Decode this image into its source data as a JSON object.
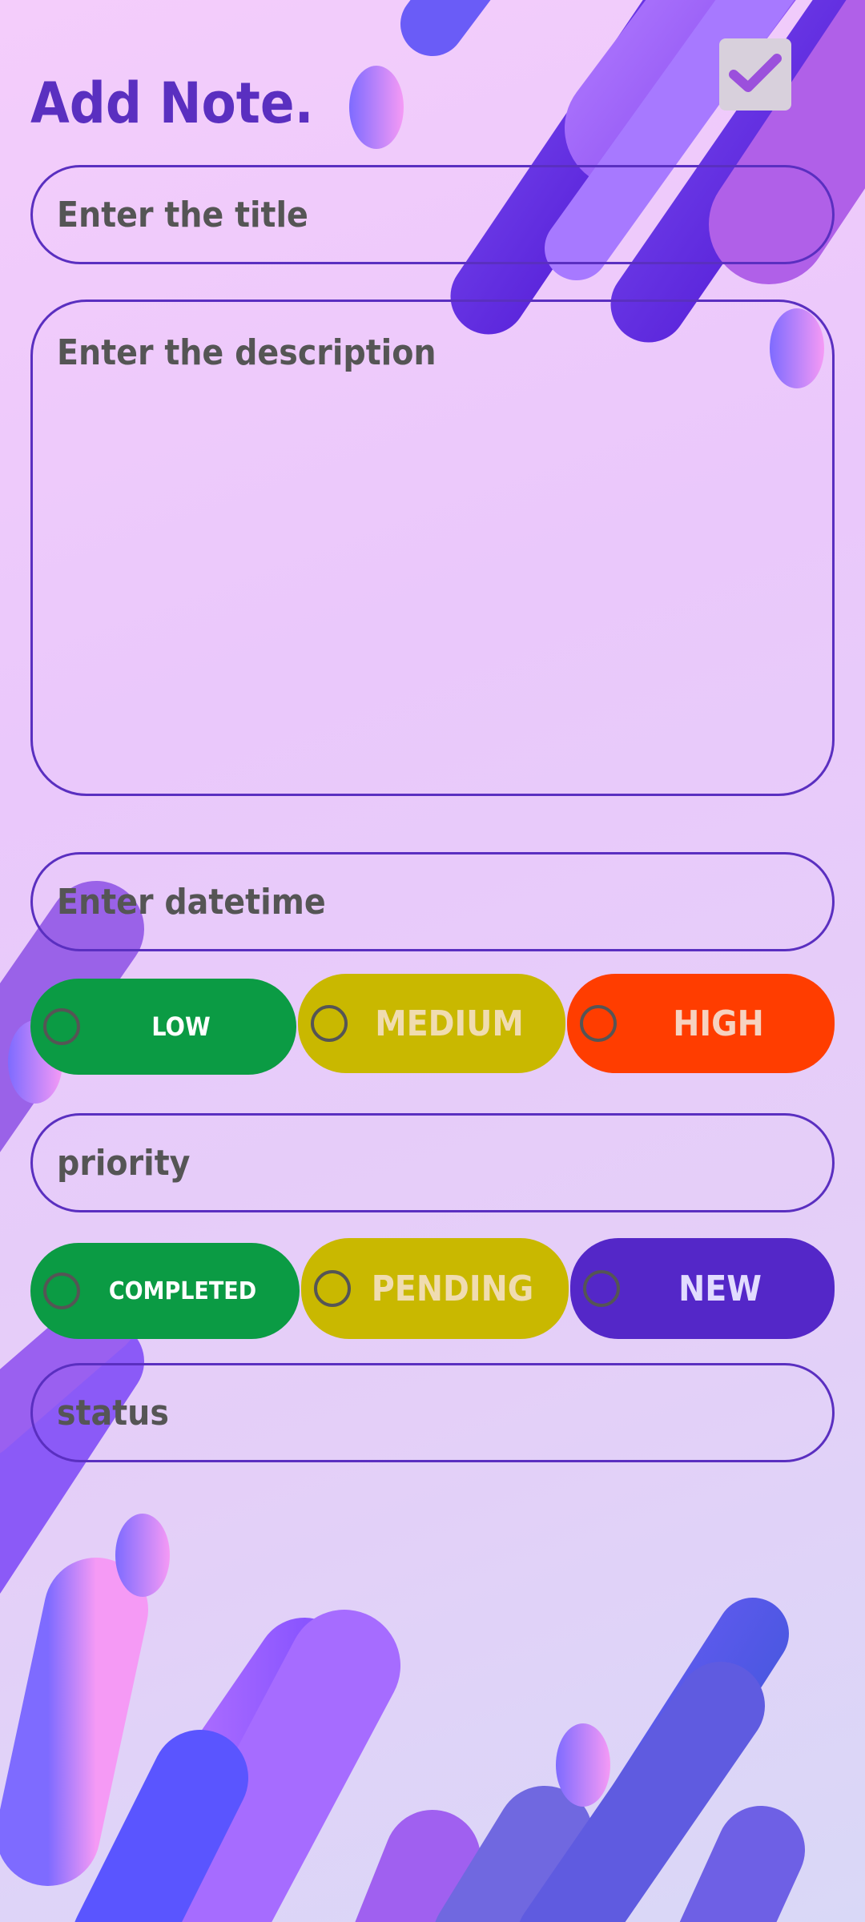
{
  "header": {
    "title": "Add Note."
  },
  "toolbar": {
    "save_icon": "checkmark-icon"
  },
  "form": {
    "title_placeholder": "Enter the title",
    "description_placeholder": "Enter the description",
    "datetime_placeholder": "Enter datetime",
    "priority_value": "priority",
    "status_value": "status"
  },
  "priority_options": [
    {
      "label": "LOW",
      "color": "#0b9b44",
      "selected": false
    },
    {
      "label": "MEDIUM",
      "color": "#c9b800",
      "selected": false
    },
    {
      "label": "HIGH",
      "color": "#ff3d00",
      "selected": false
    }
  ],
  "status_options": [
    {
      "label": "COMPLETED",
      "color": "#0b9b44",
      "selected": false
    },
    {
      "label": "PENDING",
      "color": "#c9b800",
      "selected": false
    },
    {
      "label": "NEW",
      "color": "#5427c8",
      "selected": false
    }
  ],
  "colors": {
    "accent": "#5a2fc0",
    "field_text": "#555555",
    "pale_label": "#f0dcb0"
  }
}
